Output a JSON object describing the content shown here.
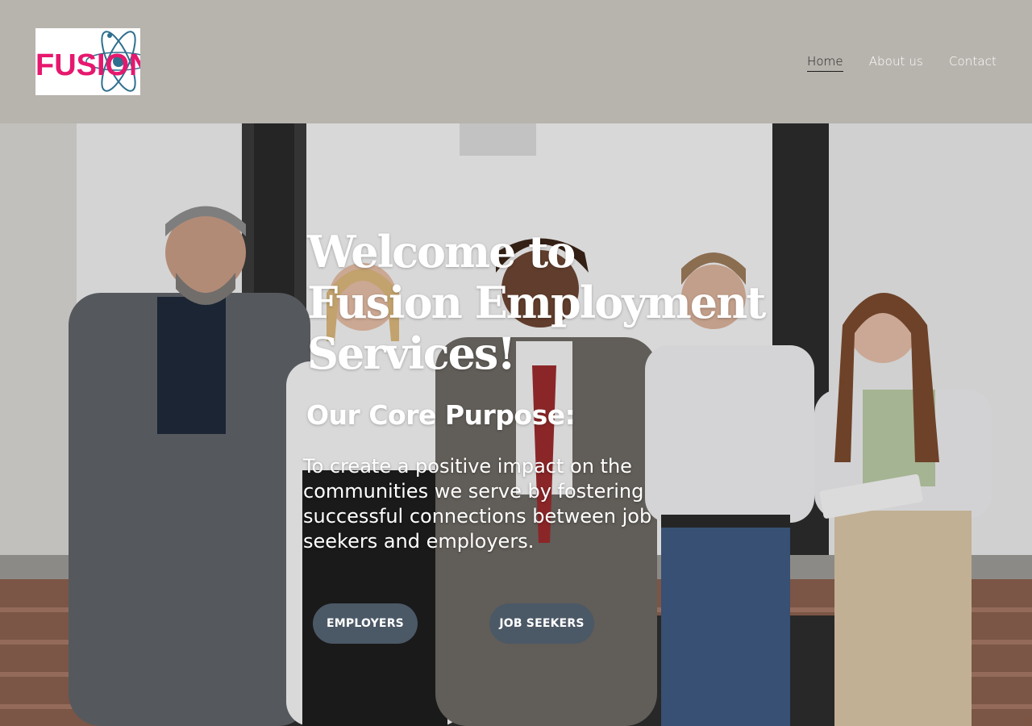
{
  "header": {
    "logo_text": "FUSION",
    "nav": [
      {
        "label": "Home",
        "active": true
      },
      {
        "label": "About us",
        "active": false
      },
      {
        "label": "Contact",
        "active": false
      }
    ]
  },
  "hero": {
    "title_lines": [
      "Welcome to",
      "Fusion Employment",
      "Services!"
    ],
    "subtitle": "Our Core Purpose:",
    "purpose": "To create a positive impact on the communities we serve by fostering successful connections between job seekers and employers.",
    "buttons": {
      "employers": "EMPLOYERS",
      "job_seekers": "JOB SEEKERS"
    },
    "background": "photo of five smiling professionals standing in front of a large window"
  },
  "colors": {
    "header_bg": "#b7b3ad",
    "button_bg": "#4b5866",
    "logo_pink": "#e6186e",
    "logo_blue": "#2f6f8f"
  }
}
